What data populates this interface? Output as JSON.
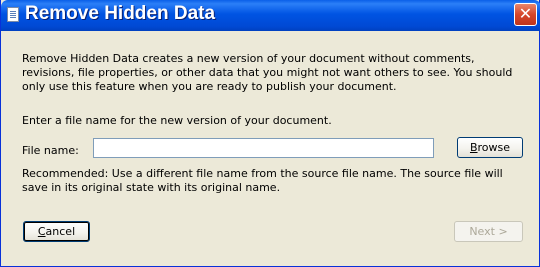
{
  "window": {
    "title": "Remove Hidden Data",
    "close_glyph": "✕"
  },
  "description": "Remove Hidden Data creates a new version of your document without comments, revisions, file properties, or other data that you might not want others to see.  You should only use this feature when you are ready to publish your document.",
  "prompt": "Enter a file name for the new version of your document.",
  "file_name": {
    "label": "File name:",
    "value": "",
    "placeholder": ""
  },
  "browse_button": {
    "accel": "B",
    "rest": "rowse"
  },
  "recommendation": "Recommended: Use a different file name from the source file name. The source file will save in its original state with its original name.",
  "cancel_button": {
    "accel": "C",
    "rest": "ancel"
  },
  "next_button": {
    "label": "Next >",
    "enabled": false
  },
  "colors": {
    "titlebar": "#0054e3",
    "close_button": "#d6462a",
    "dialog_background": "#ece9d8",
    "input_border": "#7f9db9",
    "disabled_text": "#aca899"
  }
}
